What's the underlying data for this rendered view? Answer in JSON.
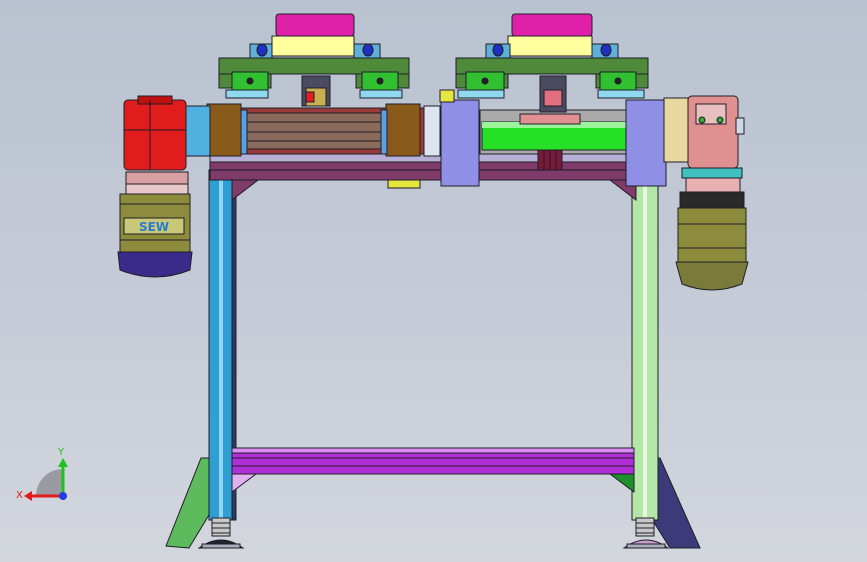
{
  "viewport": {
    "model": {
      "motor_brand": "SEW"
    },
    "triad": {
      "x_label": "X",
      "y_label": "Y",
      "x_color": "#e21b1b",
      "y_color": "#1ec31e",
      "z_color": "#1b3fe2"
    }
  }
}
